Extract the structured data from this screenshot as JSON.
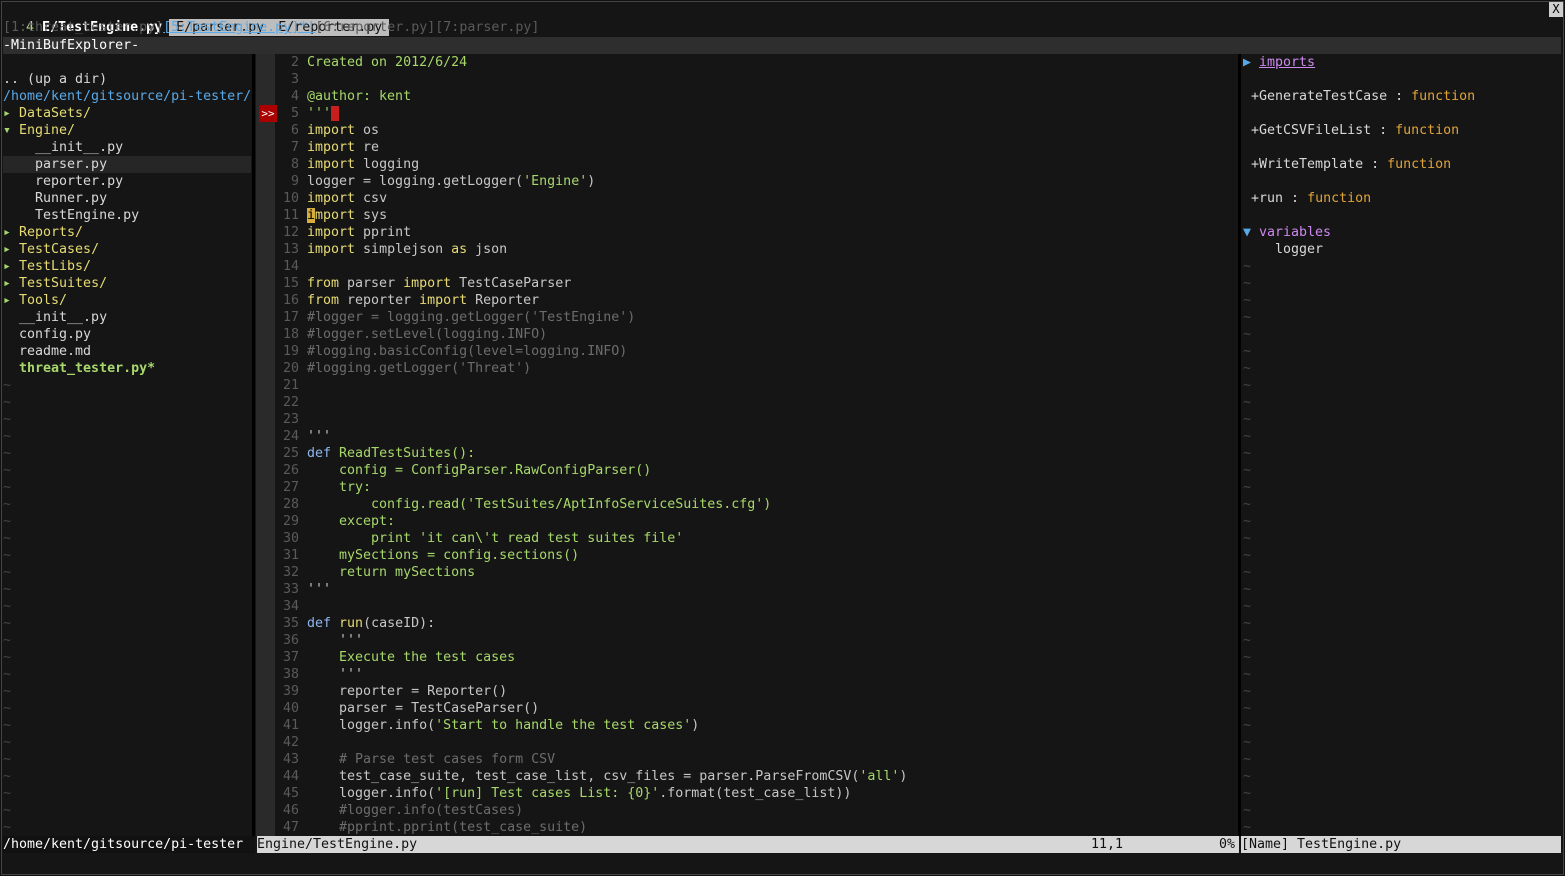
{
  "tabline": {
    "tabs": [
      {
        "num": "4",
        "label": "E/TestEngine.py",
        "selected": true
      },
      {
        "label": "E/parser.py"
      },
      {
        "label": "E/reporter.py"
      }
    ],
    "close": "X"
  },
  "minibuf": {
    "before": "[1:threat_tester.py]",
    "current": "[5:TestEngine.py]*!",
    "after": "[6:reporter.py][7:parser.py]",
    "title": "-MiniBufExplorer-"
  },
  "tree": {
    "lines": [
      {
        "text": "",
        "cls": "file"
      },
      {
        "text": ".. (up a dir)",
        "cls": "file"
      },
      {
        "text": "/home/kent/gitsource/pi-tester/",
        "cls": "link"
      },
      {
        "prefix": "▸ ",
        "text": "DataSets/",
        "cls": "dir"
      },
      {
        "prefix": "▾ ",
        "text": "Engine/",
        "cls": "dir"
      },
      {
        "text": "    __init__.py",
        "cls": "file"
      },
      {
        "text": "    parser.py",
        "cls": "file",
        "hl": true
      },
      {
        "text": "    reporter.py",
        "cls": "file"
      },
      {
        "text": "    Runner.py",
        "cls": "file"
      },
      {
        "text": "    TestEngine.py",
        "cls": "file"
      },
      {
        "prefix": "▸ ",
        "text": "Reports/",
        "cls": "dir"
      },
      {
        "prefix": "▸ ",
        "text": "TestCases/",
        "cls": "dir"
      },
      {
        "prefix": "▸ ",
        "text": "TestLibs/",
        "cls": "dir"
      },
      {
        "prefix": "▸ ",
        "text": "TestSuites/",
        "cls": "dir"
      },
      {
        "prefix": "▸ ",
        "text": "Tools/",
        "cls": "dir"
      },
      {
        "text": "  __init__.py",
        "cls": "file"
      },
      {
        "text": "  config.py",
        "cls": "file"
      },
      {
        "text": "  readme.md",
        "cls": "file"
      },
      {
        "text": "  threat_tester.py*",
        "cls": "mod"
      }
    ],
    "tilde": "~"
  },
  "code": {
    "sign": ">>",
    "lines": [
      {
        "n": "2",
        "parts": [
          [
            "doc",
            "Created on 2012/6/24"
          ]
        ]
      },
      {
        "n": "3",
        "parts": []
      },
      {
        "n": "4",
        "parts": [
          [
            "doc",
            "@author: kent"
          ]
        ]
      },
      {
        "n": "5",
        "parts": [
          [
            "doc",
            "'''"
          ],
          [
            "redcur",
            "_"
          ]
        ]
      },
      {
        "n": "6",
        "parts": [
          [
            "fn",
            "import"
          ],
          [
            "kw",
            " os"
          ]
        ]
      },
      {
        "n": "7",
        "parts": [
          [
            "fn",
            "import"
          ],
          [
            "kw",
            " re"
          ]
        ]
      },
      {
        "n": "8",
        "parts": [
          [
            "fn",
            "import"
          ],
          [
            "kw",
            " logging"
          ]
        ]
      },
      {
        "n": "9",
        "parts": [
          [
            "kw",
            "logger = logging.getLogger("
          ],
          [
            "str",
            "'Engine'"
          ],
          [
            "kw",
            ")"
          ]
        ]
      },
      {
        "n": "10",
        "parts": [
          [
            "fn",
            "import"
          ],
          [
            "kw",
            " csv"
          ]
        ]
      },
      {
        "n": "11",
        "parts": [
          [
            "cursor",
            "i"
          ],
          [
            "fn",
            "mport"
          ],
          [
            "kw",
            " sys"
          ]
        ]
      },
      {
        "n": "12",
        "parts": [
          [
            "fn",
            "import"
          ],
          [
            "kw",
            " pprint"
          ]
        ]
      },
      {
        "n": "13",
        "parts": [
          [
            "fn",
            "import"
          ],
          [
            "kw",
            " simplejson "
          ],
          [
            "fn",
            "as"
          ],
          [
            "kw",
            " json"
          ]
        ]
      },
      {
        "n": "14",
        "parts": []
      },
      {
        "n": "15",
        "parts": [
          [
            "fn",
            "from"
          ],
          [
            "kw",
            " parser "
          ],
          [
            "fn",
            "import"
          ],
          [
            "kw",
            " TestCaseParser"
          ]
        ]
      },
      {
        "n": "16",
        "parts": [
          [
            "fn",
            "from"
          ],
          [
            "kw",
            " reporter "
          ],
          [
            "fn",
            "import"
          ],
          [
            "kw",
            " Reporter"
          ]
        ]
      },
      {
        "n": "17",
        "parts": [
          [
            "cmt",
            "#logger = logging.getLogger('TestEngine')"
          ]
        ]
      },
      {
        "n": "18",
        "parts": [
          [
            "cmt",
            "#logger.setLevel(logging.INFO)"
          ]
        ]
      },
      {
        "n": "19",
        "parts": [
          [
            "cmt",
            "#logging.basicConfig(level=logging.INFO)"
          ]
        ]
      },
      {
        "n": "20",
        "parts": [
          [
            "cmt",
            "#logging.getLogger('Threat')"
          ]
        ]
      },
      {
        "n": "21",
        "parts": []
      },
      {
        "n": "22",
        "parts": []
      },
      {
        "n": "23",
        "parts": []
      },
      {
        "n": "24",
        "parts": [
          [
            "kw",
            "'''"
          ]
        ]
      },
      {
        "n": "25",
        "parts": [
          [
            "def",
            "def"
          ],
          [
            "kw",
            " "
          ],
          [
            "doc",
            "ReadTestSuites():"
          ]
        ]
      },
      {
        "n": "26",
        "parts": [
          [
            "doc",
            "    config = ConfigParser.RawConfigParser()"
          ]
        ]
      },
      {
        "n": "27",
        "parts": [
          [
            "doc",
            "    try:"
          ]
        ]
      },
      {
        "n": "28",
        "parts": [
          [
            "doc",
            "        config.read('TestSuites/AptInfoServiceSuites.cfg')"
          ]
        ]
      },
      {
        "n": "29",
        "parts": [
          [
            "doc",
            "    except:"
          ]
        ]
      },
      {
        "n": "30",
        "parts": [
          [
            "doc",
            "        print 'it can\\'t read test suites file'"
          ]
        ]
      },
      {
        "n": "31",
        "parts": [
          [
            "doc",
            "    mySections = config.sections()"
          ]
        ]
      },
      {
        "n": "32",
        "parts": [
          [
            "doc",
            "    return mySections"
          ]
        ]
      },
      {
        "n": "33",
        "parts": [
          [
            "kw",
            "'''"
          ]
        ]
      },
      {
        "n": "34",
        "parts": []
      },
      {
        "n": "35",
        "parts": [
          [
            "def",
            "def"
          ],
          [
            "kw",
            " "
          ],
          [
            "fn",
            "run"
          ],
          [
            "kw",
            "(caseID):"
          ]
        ]
      },
      {
        "n": "36",
        "parts": [
          [
            "kw",
            "    '''"
          ]
        ]
      },
      {
        "n": "37",
        "parts": [
          [
            "doc",
            "    Execute the test cases"
          ]
        ]
      },
      {
        "n": "38",
        "parts": [
          [
            "kw",
            "    '''"
          ]
        ]
      },
      {
        "n": "39",
        "parts": [
          [
            "kw",
            "    reporter = Reporter()"
          ]
        ]
      },
      {
        "n": "40",
        "parts": [
          [
            "kw",
            "    parser = TestCaseParser()"
          ]
        ]
      },
      {
        "n": "41",
        "parts": [
          [
            "kw",
            "    logger.info("
          ],
          [
            "str",
            "'Start to handle the test cases'"
          ],
          [
            "kw",
            ")"
          ]
        ]
      },
      {
        "n": "42",
        "parts": []
      },
      {
        "n": "43",
        "parts": [
          [
            "cmt",
            "    # Parse test cases form CSV"
          ]
        ]
      },
      {
        "n": "44",
        "parts": [
          [
            "kw",
            "    test_case_suite, test_case_list, csv_files = parser.ParseFromCSV("
          ],
          [
            "str",
            "'all'"
          ],
          [
            "kw",
            ")"
          ]
        ]
      },
      {
        "n": "45",
        "parts": [
          [
            "kw",
            "    logger.info("
          ],
          [
            "str",
            "'[run] Test cases List: {0}'"
          ],
          [
            "kw",
            ".format(test_case_list))"
          ]
        ]
      },
      {
        "n": "46",
        "parts": [
          [
            "cmt",
            "    #logger.info(testCases)"
          ]
        ]
      },
      {
        "n": "47",
        "parts": [
          [
            "cmt",
            "    #pprint.pprint(test_case_suite)"
          ]
        ]
      }
    ]
  },
  "tags": {
    "imports_label": "imports",
    "functions": [
      {
        "name": "+GenerateTestCase",
        "type": "function"
      },
      {
        "name": "+GetCSVFileList",
        "type": "function"
      },
      {
        "name": "+WriteTemplate",
        "type": "function"
      },
      {
        "name": "+run",
        "type": "function"
      }
    ],
    "variables_label": "variables",
    "variables": [
      "logger"
    ],
    "tilde": "~"
  },
  "status": {
    "left": "/home/kent/gitsource/pi-tester",
    "mid_file": "Engine/TestEngine.py",
    "position": "11,1",
    "percent": "0%",
    "right": "[Name] TestEngine.py"
  }
}
